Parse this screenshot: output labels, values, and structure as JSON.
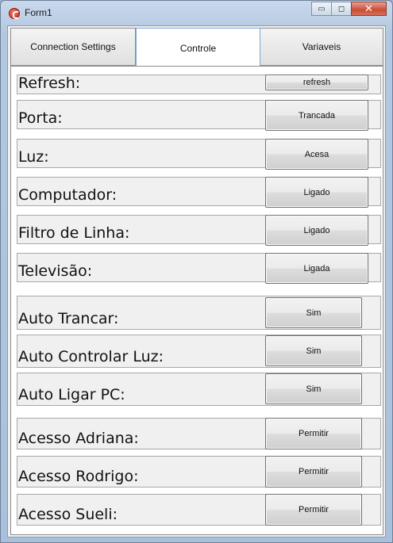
{
  "window": {
    "title": "Form1",
    "minimize_glyph": "▭",
    "maximize_glyph": "◻",
    "close_glyph": "✕"
  },
  "tabs": [
    {
      "label": "Connection Settings",
      "active": false
    },
    {
      "label": "Controle",
      "active": true
    },
    {
      "label": "Variaveis",
      "active": false
    }
  ],
  "rows": [
    {
      "label": "Refresh:",
      "button": "refresh"
    },
    {
      "label": "Porta:",
      "button": "Trancada"
    },
    {
      "label": "Luz:",
      "button": "Acesa"
    },
    {
      "label": "Computador:",
      "button": "Ligado"
    },
    {
      "label": "Filtro de Linha:",
      "button": "Ligado"
    },
    {
      "label": "Televisão:",
      "button": "Ligada"
    },
    {
      "label": "Auto Trancar:",
      "button": "Sim"
    },
    {
      "label": "Auto Controlar Luz:",
      "button": "Sim"
    },
    {
      "label": "Auto Ligar PC:",
      "button": "Sim"
    },
    {
      "label": "Acesso Adriana:",
      "button": "Permitir"
    },
    {
      "label": "Acesso Rodrigo:",
      "button": "Permitir"
    },
    {
      "label": "Acesso Sueli:",
      "button": "Permitir"
    }
  ]
}
